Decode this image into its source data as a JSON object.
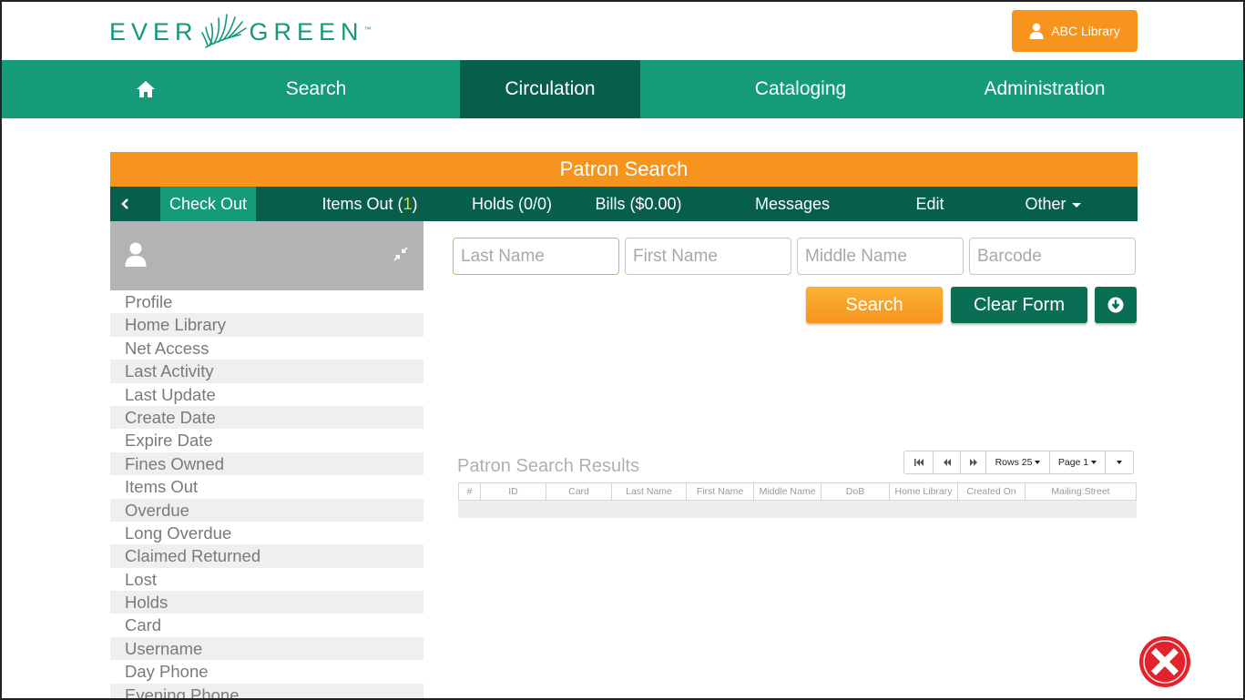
{
  "header": {
    "logo_left": "EVER",
    "logo_right": "GREEN",
    "logo_tm": "™",
    "library_button": "ABC Library"
  },
  "nav": {
    "items": [
      "Search",
      "Circulation",
      "Cataloging",
      "Administration"
    ],
    "active": "Circulation"
  },
  "patron_search": {
    "title": "Patron Search",
    "tabs": {
      "check_out": "Check Out",
      "items_out_prefix": "Items Out (",
      "items_out_count": "1",
      "items_out_suffix": ")",
      "holds": "Holds (0/0)",
      "bills": "Bills ($0.00)",
      "messages": "Messages",
      "edit": "Edit",
      "other": "Other"
    },
    "active_tab": "Check Out"
  },
  "patron_fields": [
    "Profile",
    "Home Library",
    "Net Access",
    "Last Activity",
    "Last Update",
    "Create Date",
    "Expire Date",
    "Fines Owned",
    "Items Out",
    "Overdue",
    "Long Overdue",
    "Claimed Returned",
    "Lost",
    "Holds",
    "Card",
    "Username",
    "Day Phone",
    "Evening Phone"
  ],
  "form": {
    "last_name_placeholder": "Last Name",
    "first_name_placeholder": "First Name",
    "middle_name_placeholder": "Middle Name",
    "barcode_placeholder": "Barcode",
    "search_label": "Search",
    "clear_label": "Clear Form"
  },
  "results": {
    "title": "Patron Search Results",
    "rows_label": "Rows 25",
    "page_label": "Page 1",
    "columns": [
      "#",
      "ID",
      "Card",
      "Last Name",
      "First Name",
      "Middle Name",
      "DoB",
      "Home Library",
      "Created On",
      "Mailing:Street"
    ]
  },
  "colors": {
    "brand_green": "#159a7a",
    "dark_green": "#075e4a",
    "orange": "#f7941d",
    "close_red": "#e3232b"
  },
  "icons": [
    "home-icon",
    "user-icon",
    "collapse-icon",
    "download-icon",
    "first-page-icon",
    "prev-page-icon",
    "next-page-icon",
    "close-icon",
    "chevron-left-icon"
  ]
}
